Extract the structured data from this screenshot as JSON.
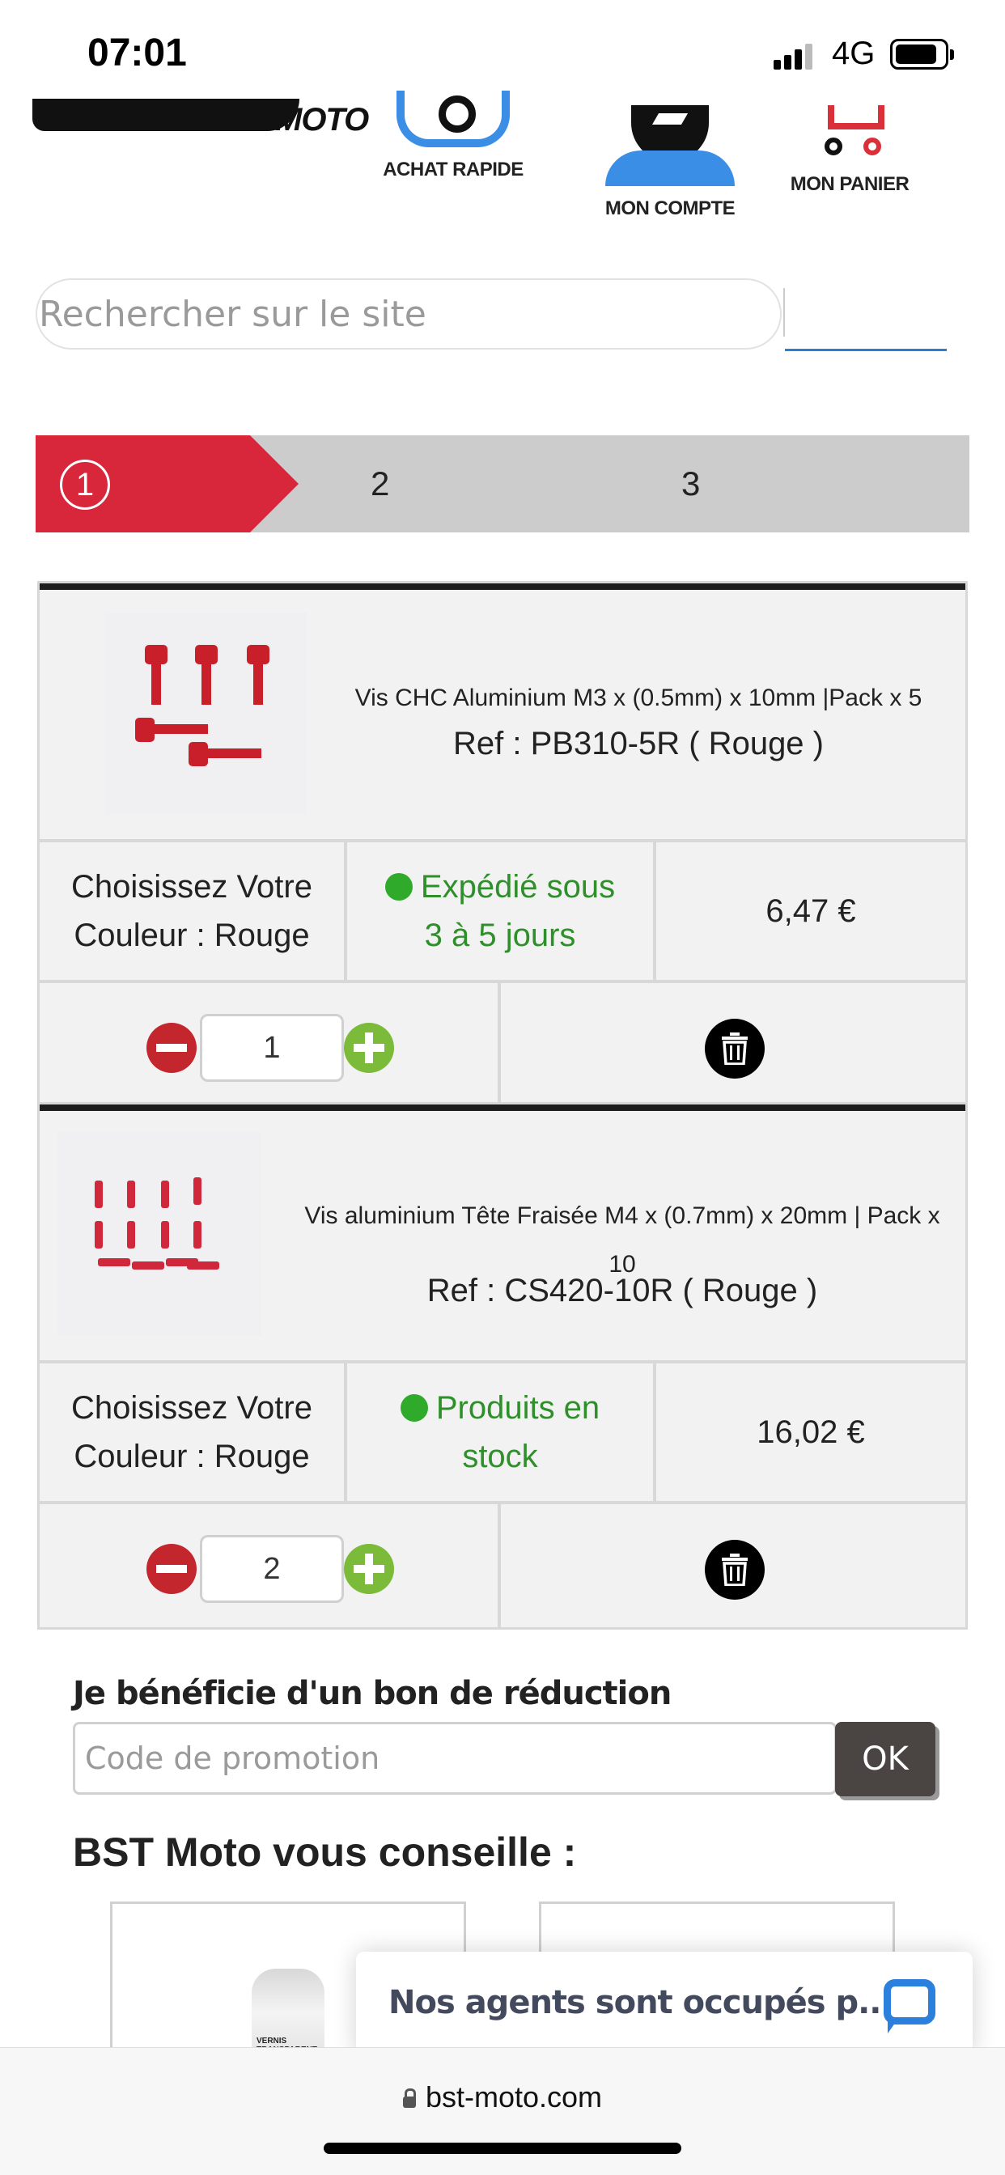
{
  "status_bar": {
    "time": "07:01",
    "network": "4G"
  },
  "header": {
    "logo_text": "MOTO",
    "nav": [
      {
        "label": "ACHAT RAPIDE",
        "icon": "quick-buy-icon"
      },
      {
        "label": "MON COMPTE",
        "icon": "account-icon"
      },
      {
        "label": "MON PANIER",
        "icon": "cart-icon"
      }
    ]
  },
  "search": {
    "placeholder": "Rechercher sur le site"
  },
  "steps": {
    "active": "1",
    "items": [
      "1",
      "2",
      "3"
    ]
  },
  "cart": {
    "items": [
      {
        "title": "Vis CHC Aluminium M3 x (0.5mm) x 10mm |Pack x 5",
        "ref": "Ref : PB310-5R ( Rouge )",
        "color_line1": "Choisissez Votre",
        "color_line2": "Couleur : Rouge",
        "availability_line1": "Expédié sous",
        "availability_line2": "3 à 5 jours",
        "price": "6,47 €",
        "quantity": "1"
      },
      {
        "title_line1": "Vis aluminium Tête Fraisée M4 x (0.7mm) x 20mm | Pack x",
        "title_line2": "10",
        "ref": "Ref : CS420-10R ( Rouge )",
        "color_line1": "Choisissez Votre",
        "color_line2": "Couleur : Rouge",
        "availability_line1": "Produits en",
        "availability_line2": "stock",
        "price": "16,02 €",
        "quantity": "2"
      }
    ]
  },
  "promo": {
    "title": "Je bénéficie d'un bon de réduction",
    "placeholder": "Code de promotion",
    "button": "OK"
  },
  "advice": {
    "title": "BST Moto vous conseille :",
    "product_label": "VERNIS TRANSPARENT"
  },
  "chat": {
    "text": "Nos agents sont occupés p..."
  },
  "browser": {
    "url": "bst-moto.com"
  },
  "colors": {
    "brand_red": "#d8263a",
    "green": "#2f8f2a",
    "blue": "#3a8ee6"
  }
}
